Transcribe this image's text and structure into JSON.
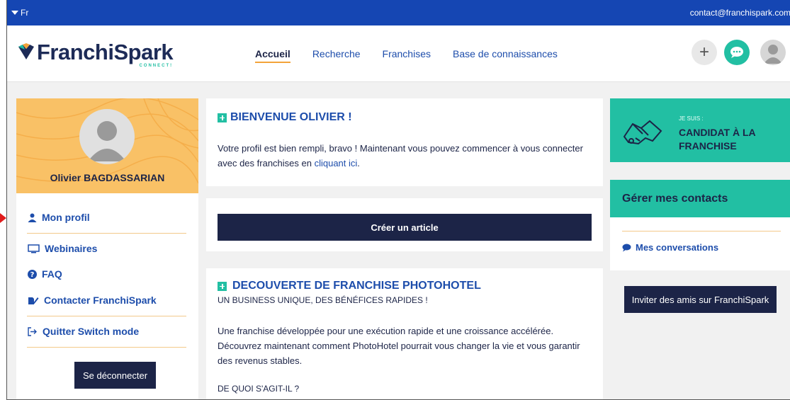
{
  "topbar": {
    "language": "Fr",
    "email": "contact@franchispark.com"
  },
  "header": {
    "logo_text": "FranchiSpark",
    "logo_sub": "CONNECT!",
    "nav": [
      {
        "label": "Accueil",
        "active": true
      },
      {
        "label": "Recherche",
        "active": false
      },
      {
        "label": "Franchises",
        "active": false
      },
      {
        "label": "Base de connaissances",
        "active": false
      }
    ],
    "plus_label": "+"
  },
  "profile": {
    "name": "Olivier BAGDASSARIAN",
    "menu": [
      {
        "label": "Mon profil",
        "icon": "user-icon"
      },
      {
        "label": "Webinaires",
        "icon": "monitor-icon"
      },
      {
        "label": "FAQ",
        "icon": "question-icon"
      },
      {
        "label": "Contacter FranchiSpark",
        "icon": "edit-icon"
      },
      {
        "label": "Quitter Switch mode",
        "icon": "sign-out-icon"
      }
    ],
    "logout_label": "Se déconnecter"
  },
  "welcome": {
    "title": "BIENVENUE OLIVIER !",
    "text_before": "Votre profil est bien rempli, bravo ! Maintenant vous pouvez commencer à vous connecter avec des franchises en ",
    "link": "cliquant ici",
    "text_after": "."
  },
  "article": {
    "button_label": "Créer un article"
  },
  "discover": {
    "title": "DECOUVERTE DE FRANCHISE PHOTOHOTEL",
    "subtitle": "UN BUSINESS UNIQUE, DES BÉNÉFICES RAPIDES !",
    "body": "Une franchise développée pour une exécution rapide et une croissance accélérée. Découvrez maintenant comment PhotoHotel pourrait vous changer la vie et vous garantir des revenus stables.",
    "question": "DE QUOI S'AGIT-IL ?"
  },
  "candidate": {
    "pre": "JE SUIS :",
    "line1": "CANDIDAT À LA",
    "line2": "FRANCHISE"
  },
  "contacts": {
    "title": "Gérer mes contacts",
    "conversations": "Mes conversations"
  },
  "invite": {
    "button_label": "Inviter des amis sur FranchiSpark"
  },
  "colors": {
    "primary_blue": "#1546b3",
    "navy": "#1c2447",
    "teal": "#22bfa3",
    "orange": "#f9c166"
  }
}
